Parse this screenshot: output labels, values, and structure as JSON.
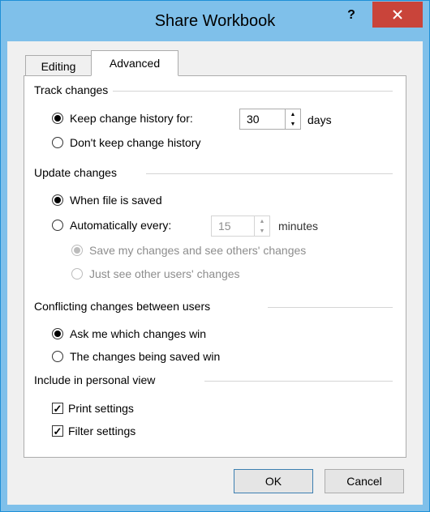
{
  "window": {
    "title": "Share Workbook",
    "help": "?",
    "close": "✕"
  },
  "tabs": [
    {
      "label": "Editing"
    },
    {
      "label": "Advanced"
    }
  ],
  "track_changes": {
    "heading": "Track changes",
    "keep_history_label": "Keep change history for:",
    "days_value": "30",
    "days_unit": "days",
    "dont_keep_label": "Don't keep change history",
    "selected": "keep"
  },
  "update_changes": {
    "heading": "Update changes",
    "when_saved_label": "When file is saved",
    "auto_every_label": "Automatically every:",
    "minutes_value": "15",
    "minutes_unit": "minutes",
    "save_and_see_label": "Save my changes and see others' changes",
    "just_see_label": "Just see other users' changes",
    "selected": "when_saved"
  },
  "conflicts": {
    "heading": "Conflicting changes between users",
    "ask_me_label": "Ask me which changes win",
    "saved_win_label": "The changes being saved win",
    "selected": "ask_me"
  },
  "personal_view": {
    "heading": "Include in personal view",
    "print_label": "Print settings",
    "print_checked": true,
    "filter_label": "Filter settings",
    "filter_checked": true
  },
  "buttons": {
    "ok": "OK",
    "cancel": "Cancel"
  }
}
